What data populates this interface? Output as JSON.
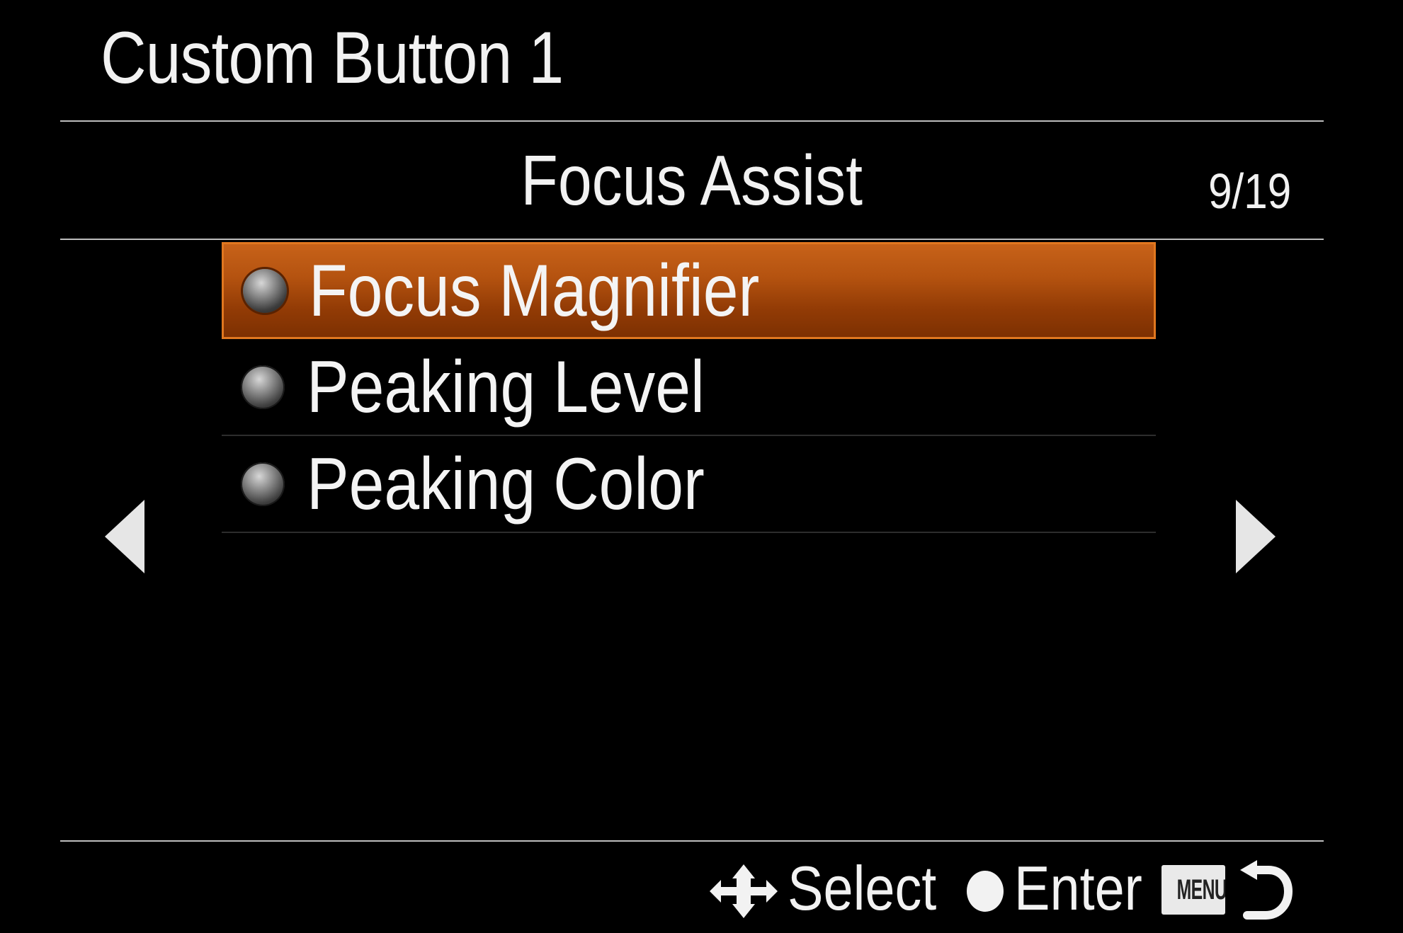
{
  "header": {
    "title": "Custom Button 1"
  },
  "section": {
    "title": "Focus Assist",
    "page_counter": "9/19"
  },
  "options": [
    {
      "label": "Focus Magnifier",
      "selected": true
    },
    {
      "label": "Peaking Level",
      "selected": false
    },
    {
      "label": "Peaking Color",
      "selected": false
    }
  ],
  "footer": {
    "select_label": "Select",
    "enter_label": "Enter",
    "menu_badge": "MENU"
  },
  "icons": {
    "nav_left": "triangle-left-icon",
    "nav_right": "triangle-right-icon",
    "dpad": "dpad-arrows-icon",
    "enter": "filled-circle-icon",
    "back": "return-arrow-icon"
  },
  "colors": {
    "background": "#000000",
    "selection": "#b55310",
    "selection_border": "#e0771f",
    "text": "#f2f2f2"
  }
}
